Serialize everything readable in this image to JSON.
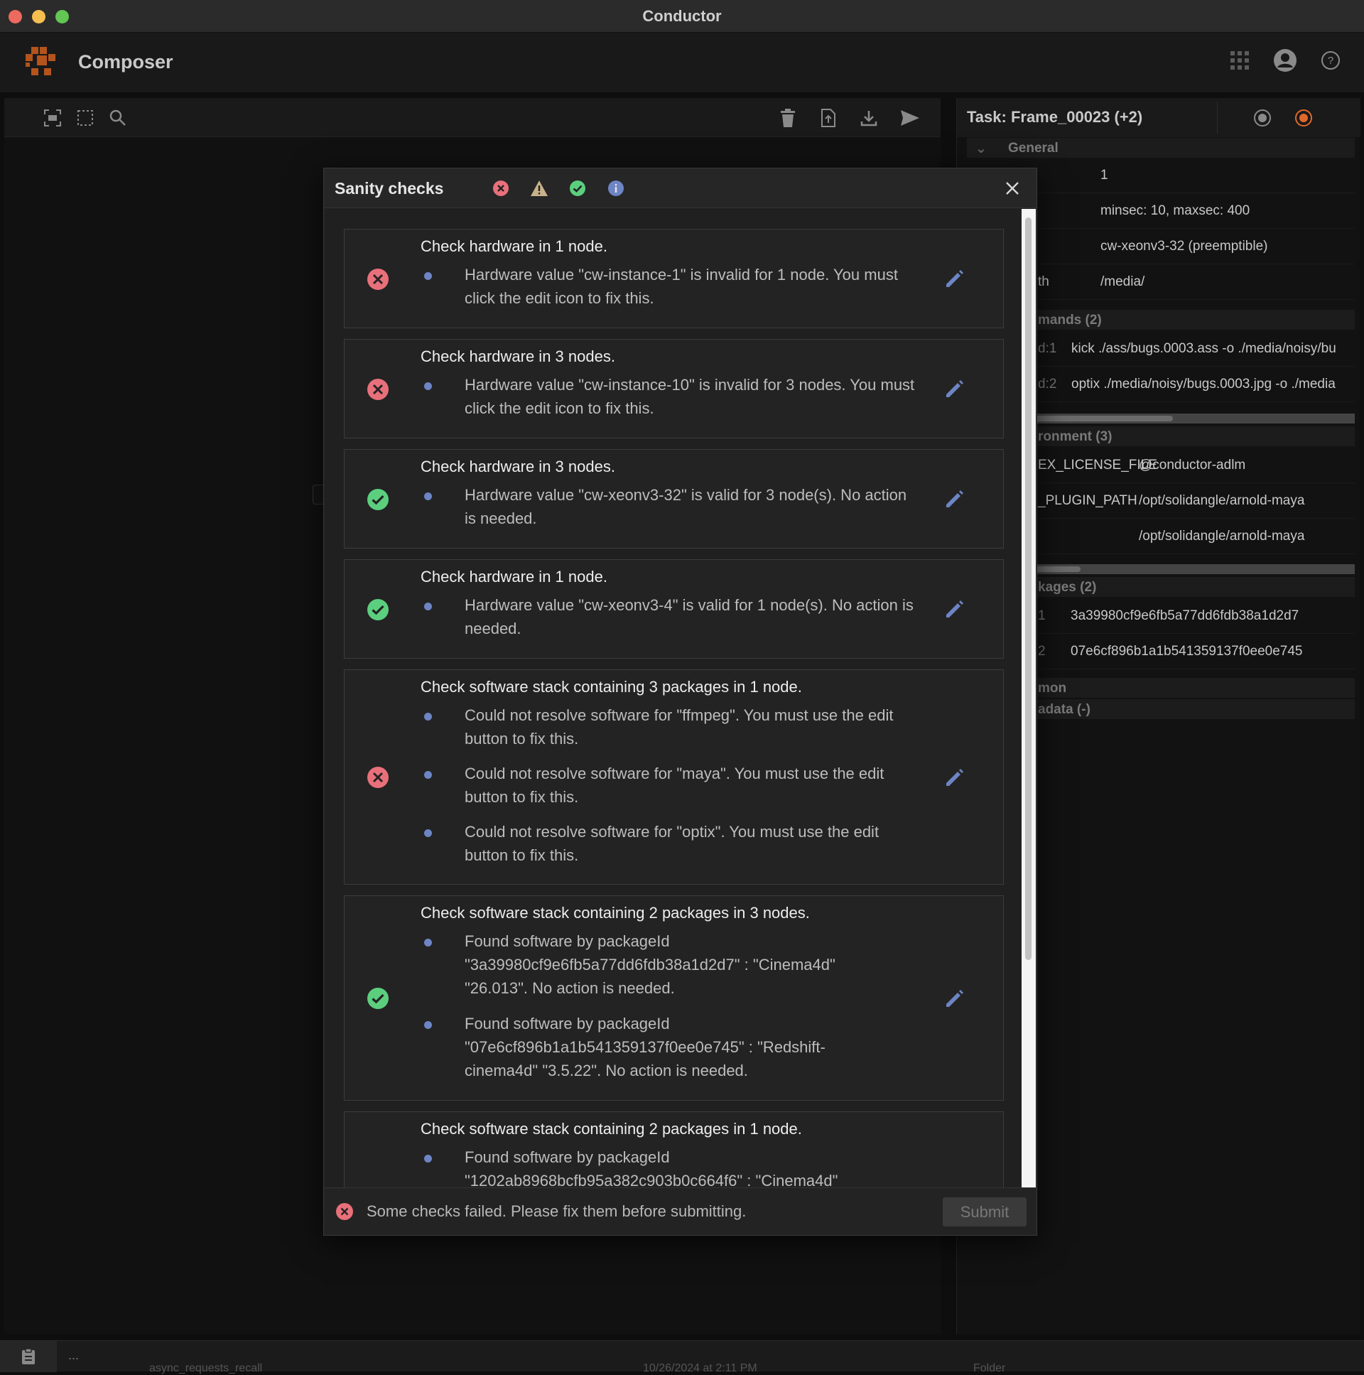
{
  "window": {
    "title": "Conductor"
  },
  "app": {
    "name": "Composer"
  },
  "task_panel": {
    "title": "Task: Frame_00023 (+2)",
    "general_label": "General",
    "general_rows": [
      "1",
      "minsec: 10, maxsec: 400",
      "cw-xeonv3-32 (preemptible)",
      "/media/"
    ],
    "general_row4_key": "th",
    "commands_label": "mands (2)",
    "commands": [
      {
        "key": "d:1",
        "value": "kick ./ass/bugs.0003.ass -o ./media/noisy/bu"
      },
      {
        "key": "d:2",
        "value": "optix ./media/noisy/bugs.0003.jpg -o ./media"
      }
    ],
    "environment_label": "ronment (3)",
    "environment": [
      {
        "key": "EX_LICENSE_FILE",
        "value": "@conductor-adlm"
      },
      {
        "key": "_PLUGIN_PATH",
        "value": "/opt/solidangle/arnold-maya"
      },
      {
        "key": "",
        "value": "/opt/solidangle/arnold-maya"
      }
    ],
    "packages_label": "kages (2)",
    "packages": [
      {
        "key": "1",
        "value": "3a39980cf9e6fb5a77dd6fdb38a1d2d7"
      },
      {
        "key": "2",
        "value": "07e6cf896b1a1b541359137f0ee0e745"
      }
    ],
    "common_label": "mon",
    "metadata_label": "adata (-)"
  },
  "dialog": {
    "title": "Sanity checks",
    "checks": [
      {
        "status": "error",
        "title": "Check hardware in 1 node.",
        "messages": [
          "Hardware value \"cw-instance-1\" is invalid for 1 node. You must click the edit icon to fix this."
        ]
      },
      {
        "status": "error",
        "title": "Check hardware in 3 nodes.",
        "messages": [
          "Hardware value \"cw-instance-10\" is invalid for 3 nodes. You must click the edit icon to fix this."
        ]
      },
      {
        "status": "success",
        "title": "Check hardware in 3 nodes.",
        "messages": [
          "Hardware value \"cw-xeonv3-32\" is valid for 3 node(s). No action is needed."
        ]
      },
      {
        "status": "success",
        "title": "Check hardware in 1 node.",
        "messages": [
          "Hardware value \"cw-xeonv3-4\" is valid for 1 node(s). No action is needed."
        ]
      },
      {
        "status": "error",
        "title": "Check software stack containing 3 packages in 1 node.",
        "messages": [
          "Could not resolve software for \"ffmpeg\". You must use the edit button to fix this.",
          "Could not resolve software for \"maya\". You must use the edit button to fix this.",
          "Could not resolve software for \"optix\". You must use the edit button to fix this."
        ]
      },
      {
        "status": "success",
        "title": "Check software stack containing 2 packages in 3 nodes.",
        "messages": [
          "Found software by packageId \"3a39980cf9e6fb5a77dd6fdb38a1d2d7\" : \"Cinema4d\" \"26.013\". No action is needed.",
          "Found software by packageId \"07e6cf896b1a1b541359137f0ee0e745\" : \"Redshift-cinema4d\" \"3.5.22\". No action is needed."
        ]
      },
      {
        "status": "success",
        "title": "Check software stack containing 2 packages in 1 node.",
        "messages": [
          "Found software by packageId \"1202ab8968bcfb95a382c903b0c664f6\" : \"Cinema4d\""
        ]
      }
    ],
    "footer_message": "Some checks failed. Please fix them before submitting.",
    "submit_label": "Submit"
  },
  "statusbar": {
    "dots": "...",
    "ghost_left": "async_requests_recall",
    "ghost_mid": "10/26/2024 at 2:11 PM",
    "ghost_right": "Folder"
  },
  "colors": {
    "error": "#e8707a",
    "warning": "#c9b28a",
    "success": "#5ccf7e",
    "info": "#6d85c4",
    "accent": "#b4541c"
  }
}
